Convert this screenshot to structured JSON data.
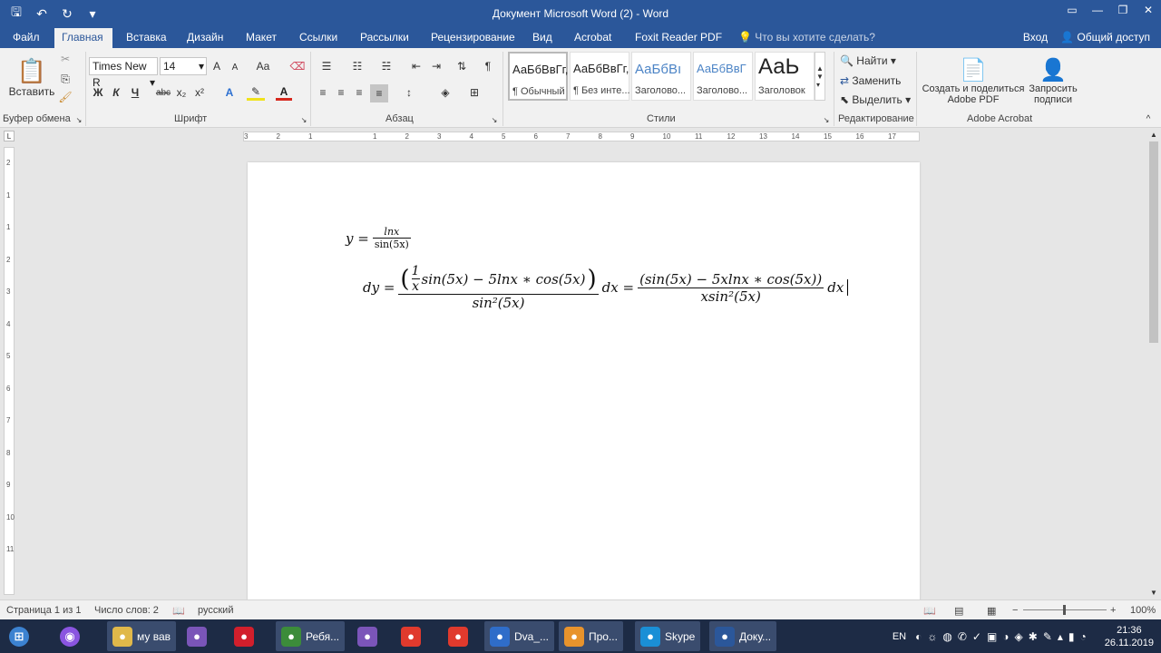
{
  "window": {
    "title": "Документ Microsoft Word (2) - Word"
  },
  "tabs": [
    "Файл",
    "Главная",
    "Вставка",
    "Дизайн",
    "Макет",
    "Ссылки",
    "Рассылки",
    "Рецензирование",
    "Вид",
    "Acrobat",
    "Foxit Reader PDF"
  ],
  "tell_me": "Что вы хотите сделать?",
  "account": {
    "login": "Вход",
    "share": "Общий доступ"
  },
  "ribbon": {
    "clipboard": {
      "paste": "Вставить",
      "label": "Буфер обмена"
    },
    "font": {
      "name": "Times New R",
      "size": "14",
      "label": "Шрифт",
      "bold": "Ж",
      "italic": "К",
      "underline": "Ч",
      "strike": "abc",
      "sub": "x₂",
      "sup": "x²",
      "grow": "A",
      "shrink": "A",
      "case": "Aa"
    },
    "paragraph": {
      "label": "Абзац",
      "pilcrow": "¶"
    },
    "styles": {
      "label": "Стили",
      "items": [
        {
          "sample": "АаБбВвГг,",
          "name": "¶ Обычный"
        },
        {
          "sample": "АаБбВвГг,",
          "name": "¶ Без инте..."
        },
        {
          "sample": "АаБбВı",
          "name": "Заголово..."
        },
        {
          "sample": "АаБбВвГ",
          "name": "Заголово..."
        },
        {
          "sample": "АаЬ",
          "name": "Заголовок"
        }
      ]
    },
    "editing": {
      "label": "Редактирование",
      "find": "Найти",
      "replace": "Заменить",
      "select": "Выделить"
    },
    "acrobat": {
      "label": "Adobe Acrobat",
      "create": "Создать и поделиться Adobe PDF",
      "request": "Запросить подписи"
    }
  },
  "ruler": {
    "h_ticks": [
      "3",
      "2",
      "1",
      "1",
      "2",
      "3",
      "4",
      "5",
      "6",
      "7",
      "8",
      "9",
      "10",
      "11",
      "12",
      "13",
      "14",
      "15",
      "16",
      "17"
    ],
    "v_ticks": [
      "2",
      "1",
      "1",
      "2",
      "3",
      "4",
      "5",
      "6",
      "7",
      "8",
      "9",
      "10",
      "11"
    ]
  },
  "document": {
    "eq1": {
      "lhs": "y =",
      "num": "lnx",
      "den": "sin(5x)"
    },
    "eq2": {
      "lhs": "dy =",
      "num1": "sin(5x) − 5lnx ∗ cos(5x)",
      "inner_num": "1",
      "inner_den": "x",
      "den1": "sin²(5x)",
      "mid": "dx =",
      "num2": "(sin(5x) − 5xlnx ∗ cos(5x))",
      "den2": "xsin²(5x)",
      "tail": "dx"
    }
  },
  "status": {
    "page": "Страница 1 из 1",
    "words": "Число слов: 2",
    "lang": "русский",
    "zoom": "100%"
  },
  "taskbar": {
    "items": [
      {
        "label": "му вав",
        "icon": "folder-icon",
        "color": "#e0b84a"
      },
      {
        "label": "",
        "icon": "visual-studio-icon",
        "color": "#7a55b8"
      },
      {
        "label": "",
        "icon": "opera-icon",
        "color": "#d21f2c"
      },
      {
        "label": "Ребя...",
        "icon": "chrome-icon",
        "color": "#3c8c3a"
      },
      {
        "label": "",
        "icon": "viber-icon",
        "color": "#7b55b9"
      },
      {
        "label": "",
        "icon": "yandex-icon",
        "color": "#e03a2d"
      },
      {
        "label": "",
        "icon": "yandex-browser-icon",
        "color": "#e03a2d"
      },
      {
        "label": "Dva_...",
        "icon": "document-icon",
        "color": "#2f6dc9"
      },
      {
        "label": "Про...",
        "icon": "player-icon",
        "color": "#e8932c"
      },
      {
        "label": "Skype",
        "icon": "skype-icon",
        "color": "#1a8fd6"
      },
      {
        "label": "Доку...",
        "icon": "word-icon",
        "color": "#2b579a"
      }
    ],
    "lang": "EN",
    "time": "21:36",
    "date": "26.11.2019"
  }
}
